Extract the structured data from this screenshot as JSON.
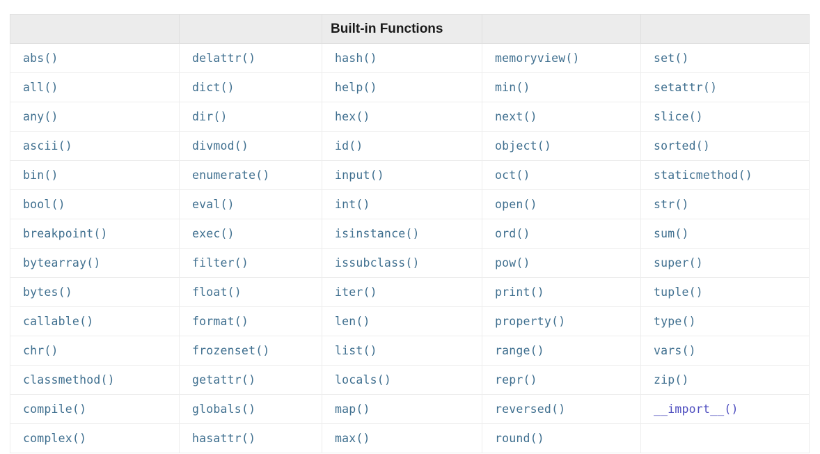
{
  "header": {
    "title": "Built-in Functions",
    "empty_label": ""
  },
  "colors": {
    "header_background": "#ececec",
    "header_text": "#1a1a1a",
    "function_text": "#3f6f8f",
    "dunder_text": "#4d4dbf",
    "grid_line": "#ededed",
    "table_border": "#e6e6e6",
    "page_background": "#ffffff"
  },
  "table": {
    "column_count": 5,
    "row_count": 14,
    "rows": [
      [
        "abs()",
        "delattr()",
        "hash()",
        "memoryview()",
        "set()"
      ],
      [
        "all()",
        "dict()",
        "help()",
        "min()",
        "setattr()"
      ],
      [
        "any()",
        "dir()",
        "hex()",
        "next()",
        "slice()"
      ],
      [
        "ascii()",
        "divmod()",
        "id()",
        "object()",
        "sorted()"
      ],
      [
        "bin()",
        "enumerate()",
        "input()",
        "oct()",
        "staticmethod()"
      ],
      [
        "bool()",
        "eval()",
        "int()",
        "open()",
        "str()"
      ],
      [
        "breakpoint()",
        "exec()",
        "isinstance()",
        "ord()",
        "sum()"
      ],
      [
        "bytearray()",
        "filter()",
        "issubclass()",
        "pow()",
        "super()"
      ],
      [
        "bytes()",
        "float()",
        "iter()",
        "print()",
        "tuple()"
      ],
      [
        "callable()",
        "format()",
        "len()",
        "property()",
        "type()"
      ],
      [
        "chr()",
        "frozenset()",
        "list()",
        "range()",
        "vars()"
      ],
      [
        "classmethod()",
        "getattr()",
        "locals()",
        "repr()",
        "zip()"
      ],
      [
        "compile()",
        "globals()",
        "map()",
        "reversed()",
        "__import__()"
      ],
      [
        "complex()",
        "hasattr()",
        "max()",
        "round()",
        ""
      ]
    ]
  }
}
